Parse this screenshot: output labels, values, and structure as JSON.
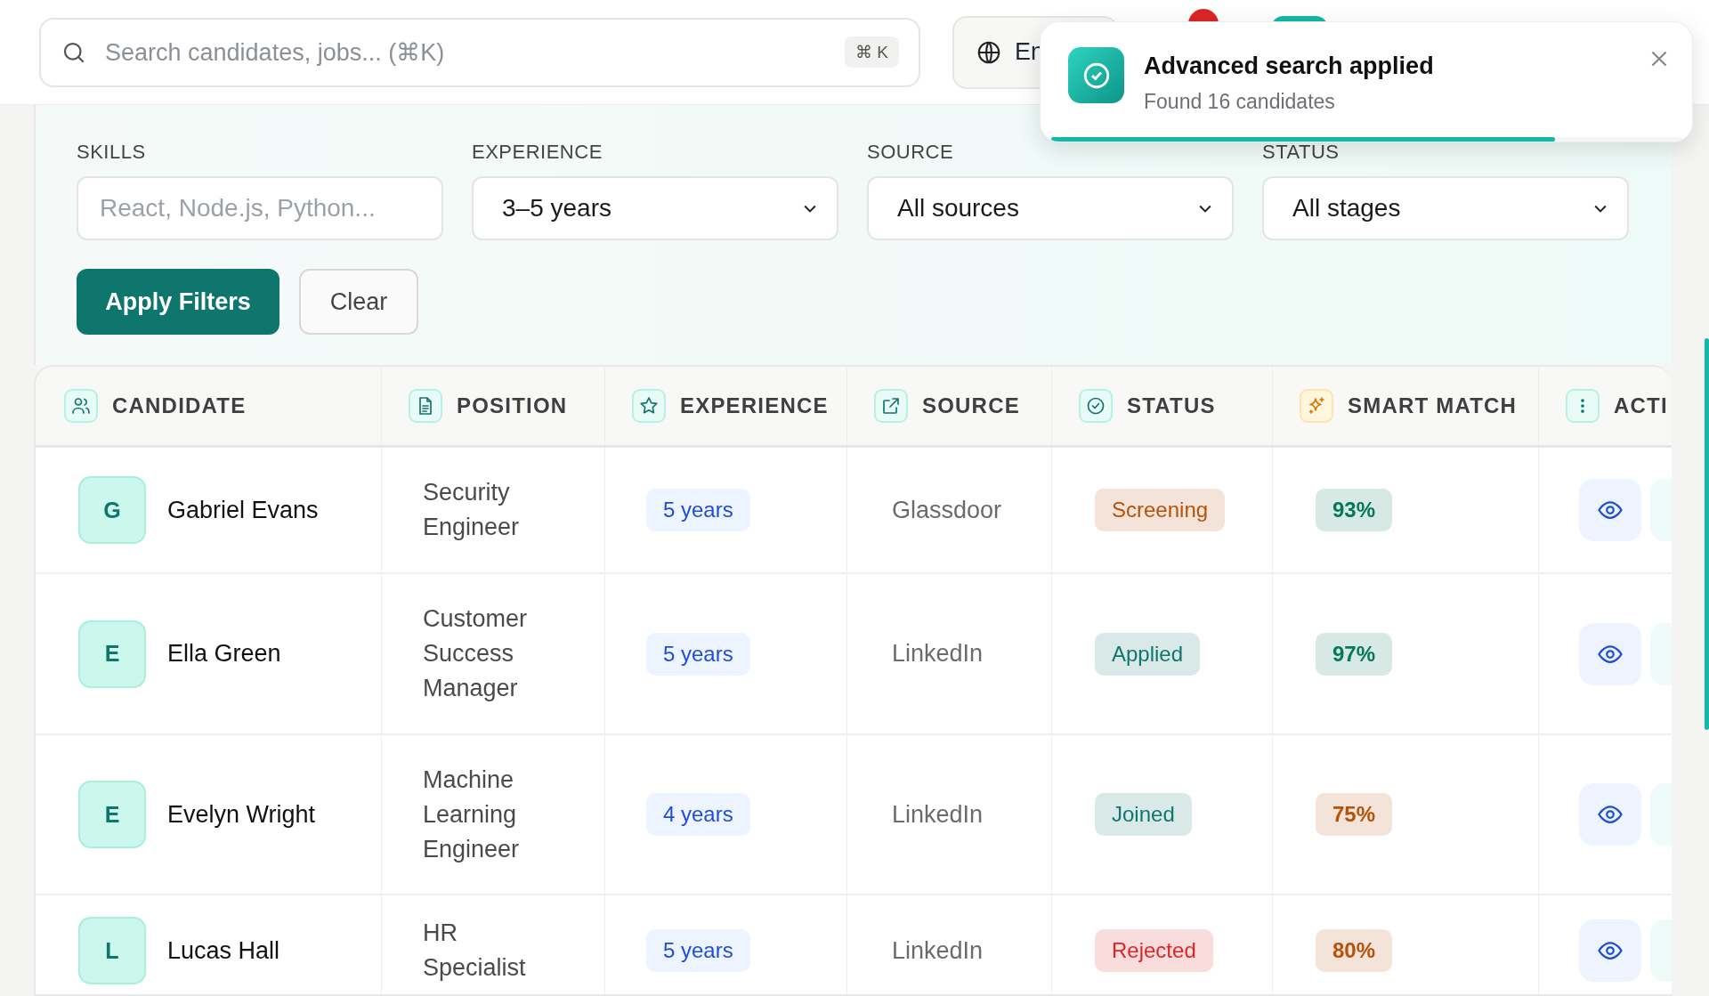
{
  "search": {
    "placeholder": "Search candidates, jobs... (⌘K)",
    "shortcut": "⌘ K"
  },
  "language_button": {
    "label": "En"
  },
  "toast": {
    "title": "Advanced search applied",
    "message": "Found 16 candidates",
    "level": 0.8
  },
  "filters": {
    "fields": [
      {
        "label": "SKILLS",
        "kind": "text",
        "placeholder": "React, Node.js, Python..."
      },
      {
        "label": "EXPERIENCE",
        "kind": "select",
        "value": "3–5 years"
      },
      {
        "label": "SOURCE",
        "kind": "select",
        "value": "All sources"
      },
      {
        "label": "STATUS",
        "kind": "select",
        "value": "All stages"
      }
    ],
    "buttons": [
      {
        "label": "Apply Filters",
        "kind": "primary"
      },
      {
        "label": "Clear",
        "kind": "secondary"
      }
    ]
  },
  "table": {
    "columns": [
      "CANDIDATE",
      "POSITION",
      "EXPERIENCE",
      "SOURCE",
      "STATUS",
      "SMART MATCH",
      "ACTI"
    ],
    "rows": [
      {
        "initial": "G",
        "name": "Gabriel Evans",
        "position": "Security Engineer",
        "experience": "5 years",
        "source": "Glassdoor",
        "status": {
          "label": "Screening",
          "color": "#b45309"
        },
        "match": {
          "label": "93%",
          "color": "#047857"
        }
      },
      {
        "initial": "E",
        "name": "Ella Green",
        "position": "Customer Success Manager",
        "experience": "5 years",
        "source": "LinkedIn",
        "status": {
          "label": "Applied",
          "color": "#0f766e"
        },
        "match": {
          "label": "97%",
          "color": "#047857"
        }
      },
      {
        "initial": "E",
        "name": "Evelyn Wright",
        "position": "Machine Learning Engineer",
        "experience": "4 years",
        "source": "LinkedIn",
        "status": {
          "label": "Joined",
          "color": "#0f766e"
        },
        "match": {
          "label": "75%",
          "color": "#b45309"
        }
      },
      {
        "initial": "L",
        "name": "Lucas Hall",
        "position": "HR Specialist",
        "experience": "5 years",
        "source": "LinkedIn",
        "status": {
          "label": "Rejected",
          "color": "#dc2626"
        },
        "match": {
          "label": "80%",
          "color": "#b45309"
        }
      }
    ]
  }
}
